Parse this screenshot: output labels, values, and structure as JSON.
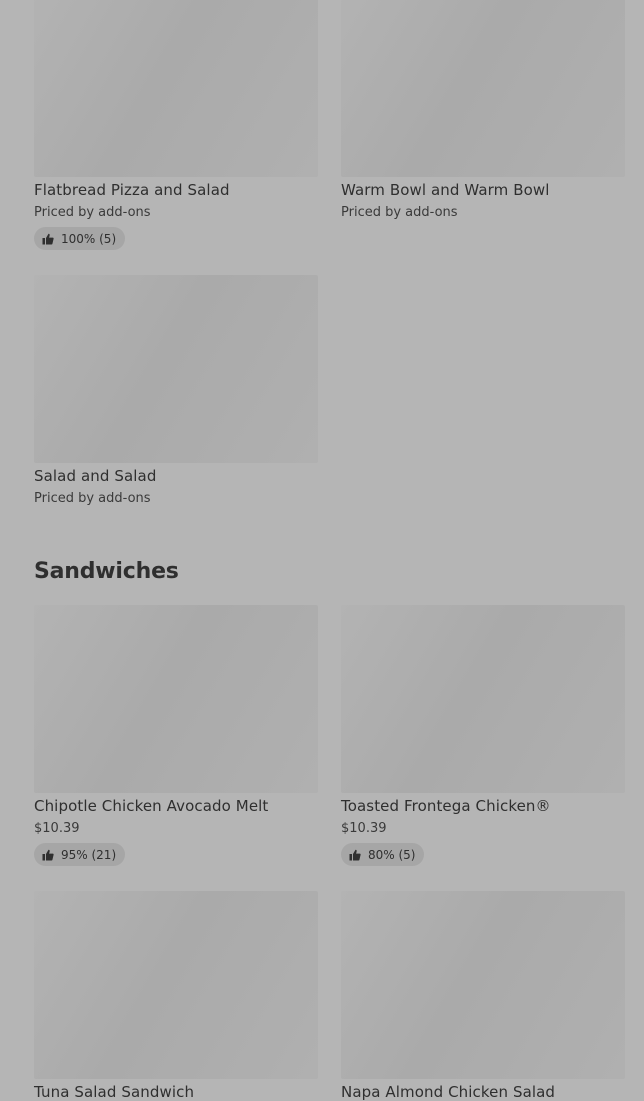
{
  "sections": {
    "top": {
      "items": [
        {
          "name": "Flatbread Pizza and Salad",
          "price": "Priced by add-ons",
          "rating": "100% (5)"
        },
        {
          "name": "Warm Bowl and Warm Bowl",
          "price": "Priced by add-ons"
        },
        {
          "name": "Salad and Salad",
          "price": "Priced by add-ons"
        }
      ]
    },
    "sandwiches": {
      "title": "Sandwiches",
      "items": [
        {
          "name": "Chipotle Chicken Avocado Melt",
          "price": "$10.39",
          "rating": "95% (21)"
        },
        {
          "name": "Toasted Frontega Chicken®",
          "price": "$10.39",
          "rating": "80% (5)"
        },
        {
          "name": "Tuna Salad Sandwich"
        },
        {
          "name": "Napa Almond Chicken Salad"
        }
      ]
    }
  },
  "icons": {
    "rating": "thumbs-up-icon"
  },
  "colors": {
    "background": "#b5b5b5",
    "image_placeholder": "#acacac",
    "rating_badge": "#a6a6a6",
    "text": "#2f2f2f"
  }
}
